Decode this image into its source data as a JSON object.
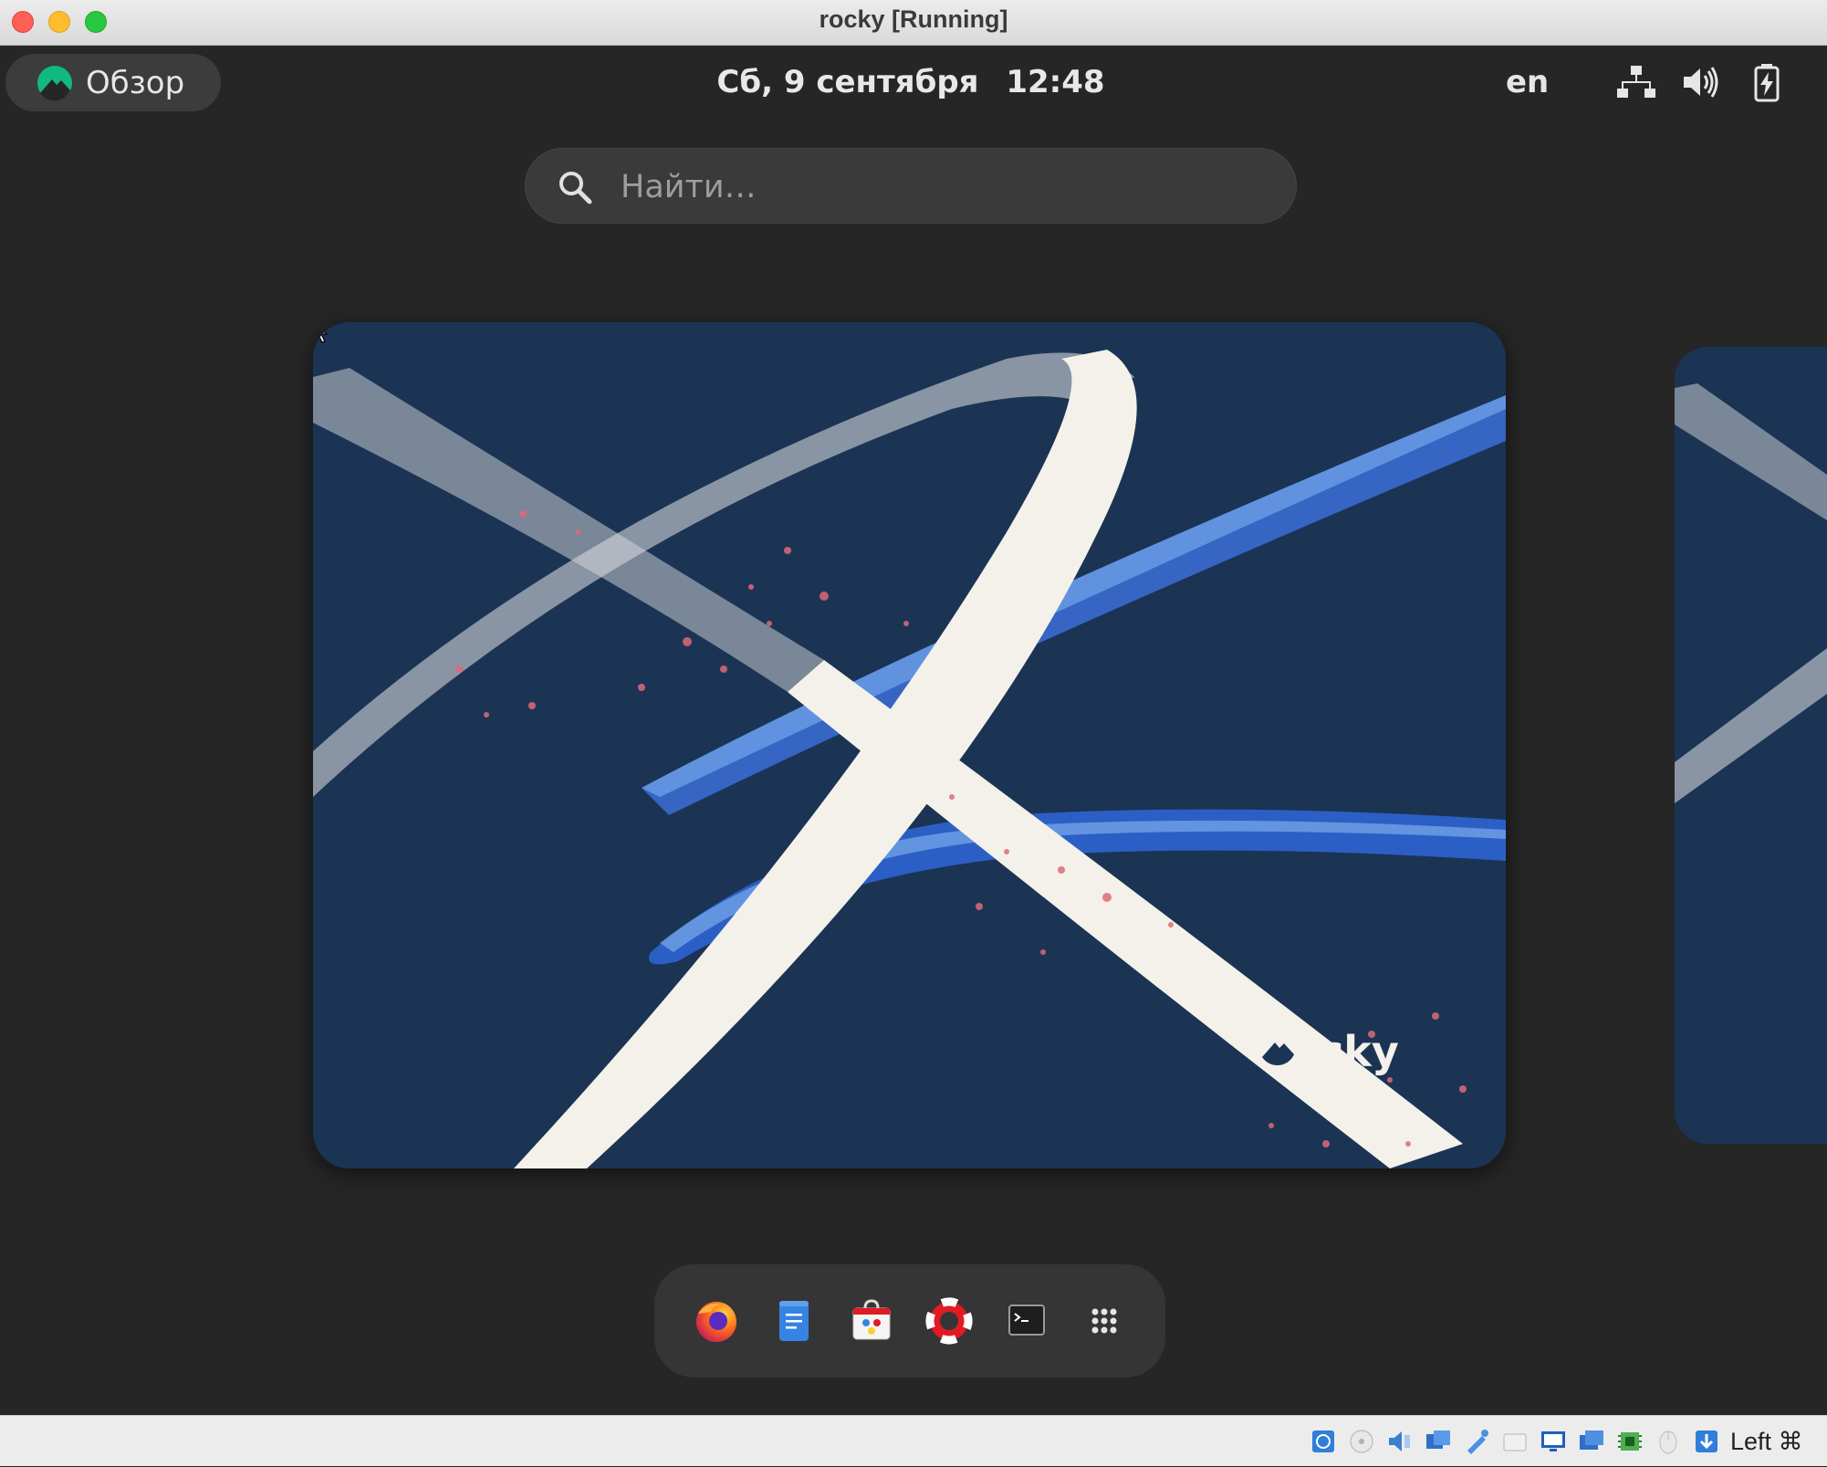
{
  "host_window": {
    "title": "rocky [Running]",
    "buttons": [
      "close",
      "minimize",
      "maximize"
    ]
  },
  "top_bar": {
    "activities_label": "Обзор",
    "activities_icon": "rocky-logo-icon",
    "date": "Сб, 9 сентября",
    "time": "12:48",
    "language": "en",
    "system_icons": [
      "network-icon",
      "volume-icon",
      "battery-icon"
    ]
  },
  "search": {
    "placeholder": "Найти…",
    "value": ""
  },
  "workspace": {
    "brand_text": "Rocky",
    "colors": {
      "background": "#1b3454",
      "ribbon": "#f4f1ea",
      "accent_blue": "#3b6fd8",
      "speckle": "#e0697a"
    }
  },
  "dash": {
    "items": [
      {
        "name": "firefox-icon"
      },
      {
        "name": "text-editor-icon"
      },
      {
        "name": "software-icon"
      },
      {
        "name": "help-icon"
      },
      {
        "name": "terminal-icon"
      },
      {
        "name": "show-apps-icon"
      }
    ]
  },
  "vbox_status": {
    "icons": [
      "hard-disk-icon",
      "optical-drive-icon",
      "audio-icon",
      "network-adapter-icon",
      "usb-icon",
      "shared-folders-icon",
      "display-icon",
      "video-capture-icon",
      "cpu-icon",
      "mouse-integration-icon",
      "keyboard-capture-icon"
    ],
    "host_key": "Left ⌘"
  }
}
